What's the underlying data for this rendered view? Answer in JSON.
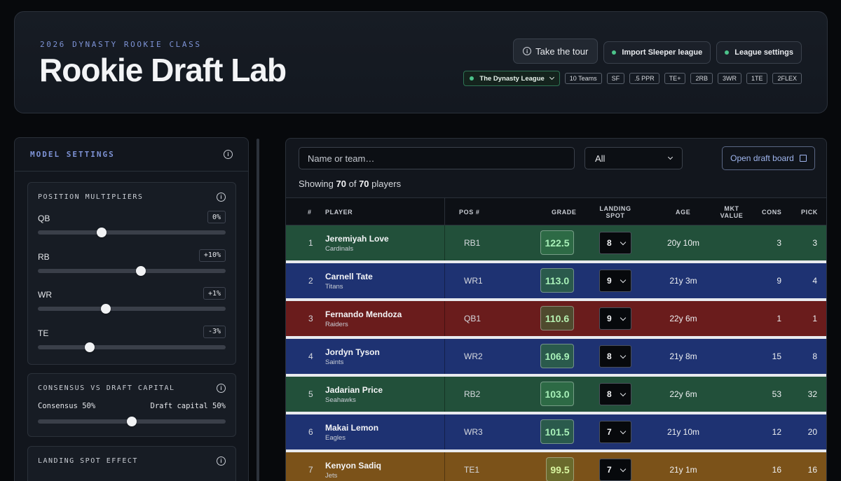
{
  "header": {
    "eyebrow": "2026 DYNASTY ROOKIE CLASS",
    "title": "Rookie Draft Lab",
    "tour_label": "Take the tour",
    "import_label": "Import Sleeper league",
    "settings_label": "League settings",
    "league_name": "The Dynasty League",
    "chips": [
      "10 Teams",
      "SF",
      ".5 PPR",
      "TE+",
      "2RB",
      "3WR",
      "1TE",
      "2FLEX"
    ]
  },
  "sidebar": {
    "title": "MODEL SETTINGS",
    "position_multipliers": {
      "title": "POSITION MULTIPLIERS",
      "sliders": [
        {
          "label": "QB",
          "value": "0%",
          "level": 0.34
        },
        {
          "label": "RB",
          "value": "+10%",
          "level": 0.549
        },
        {
          "label": "WR",
          "value": "+1%",
          "level": 0.362
        },
        {
          "label": "TE",
          "value": "-3%",
          "level": 0.276
        }
      ]
    },
    "consensus": {
      "title": "CONSENSUS VS DRAFT CAPITAL",
      "left_label": "Consensus 50%",
      "right_label": "Draft capital 50%",
      "level": 0.5
    },
    "landing": {
      "title": "LANDING SPOT EFFECT"
    }
  },
  "main": {
    "search_placeholder": "Name or team…",
    "filter_value": "All",
    "open_board_label": "Open draft board",
    "showing_prefix": "Showing",
    "showing_count": "70",
    "showing_of": "of",
    "showing_total": "70",
    "showing_suffix": "players",
    "columns": {
      "rank": "#",
      "player": "PLAYER",
      "pos": "POS #",
      "grade": "GRADE",
      "landing": "LANDING SPOT",
      "age": "AGE",
      "mkt": "MKT VALUE",
      "cons": "CONS",
      "pick": "PICK"
    },
    "rows": [
      {
        "rank": "1",
        "name": "Jeremiyah Love",
        "team": "Cardinals",
        "pos": "RB1",
        "grade": "122.5",
        "spot": "8",
        "age": "20y 10m",
        "mkt": "",
        "cons": "3",
        "pick": "3",
        "color": "#22503a",
        "grade_bg": "#2d6a45",
        "grade_fg": "#a8f0b8"
      },
      {
        "rank": "2",
        "name": "Carnell Tate",
        "team": "Titans",
        "pos": "WR1",
        "grade": "113.0",
        "spot": "9",
        "age": "21y 3m",
        "mkt": "",
        "cons": "9",
        "pick": "4",
        "color": "#1e3272",
        "grade_bg": "#2a5a4c",
        "grade_fg": "#a8f0b8"
      },
      {
        "rank": "3",
        "name": "Fernando Mendoza",
        "team": "Raiders",
        "pos": "QB1",
        "grade": "110.6",
        "spot": "9",
        "age": "22y 6m",
        "mkt": "",
        "cons": "1",
        "pick": "1",
        "color": "#6a1c1c",
        "grade_bg": "#4f4a2e",
        "grade_fg": "#b6f0b0"
      },
      {
        "rank": "4",
        "name": "Jordyn Tyson",
        "team": "Saints",
        "pos": "WR2",
        "grade": "106.9",
        "spot": "8",
        "age": "21y 8m",
        "mkt": "",
        "cons": "15",
        "pick": "8",
        "color": "#1e3272",
        "grade_bg": "#2a5a4c",
        "grade_fg": "#a8f0b8"
      },
      {
        "rank": "5",
        "name": "Jadarian Price",
        "team": "Seahawks",
        "pos": "RB2",
        "grade": "103.0",
        "spot": "8",
        "age": "22y 6m",
        "mkt": "",
        "cons": "53",
        "pick": "32",
        "color": "#22503a",
        "grade_bg": "#2d6a45",
        "grade_fg": "#a8f0b8"
      },
      {
        "rank": "6",
        "name": "Makai Lemon",
        "team": "Eagles",
        "pos": "WR3",
        "grade": "101.5",
        "spot": "7",
        "age": "21y 10m",
        "mkt": "",
        "cons": "12",
        "pick": "20",
        "color": "#1e3272",
        "grade_bg": "#2a5a4c",
        "grade_fg": "#a8f0b8"
      },
      {
        "rank": "7",
        "name": "Kenyon Sadiq",
        "team": "Jets",
        "pos": "TE1",
        "grade": "99.5",
        "spot": "7",
        "age": "21y 1m",
        "mkt": "",
        "cons": "16",
        "pick": "16",
        "color": "#7b5219",
        "grade_bg": "#6a6a2c",
        "grade_fg": "#d8f5a0"
      }
    ]
  }
}
